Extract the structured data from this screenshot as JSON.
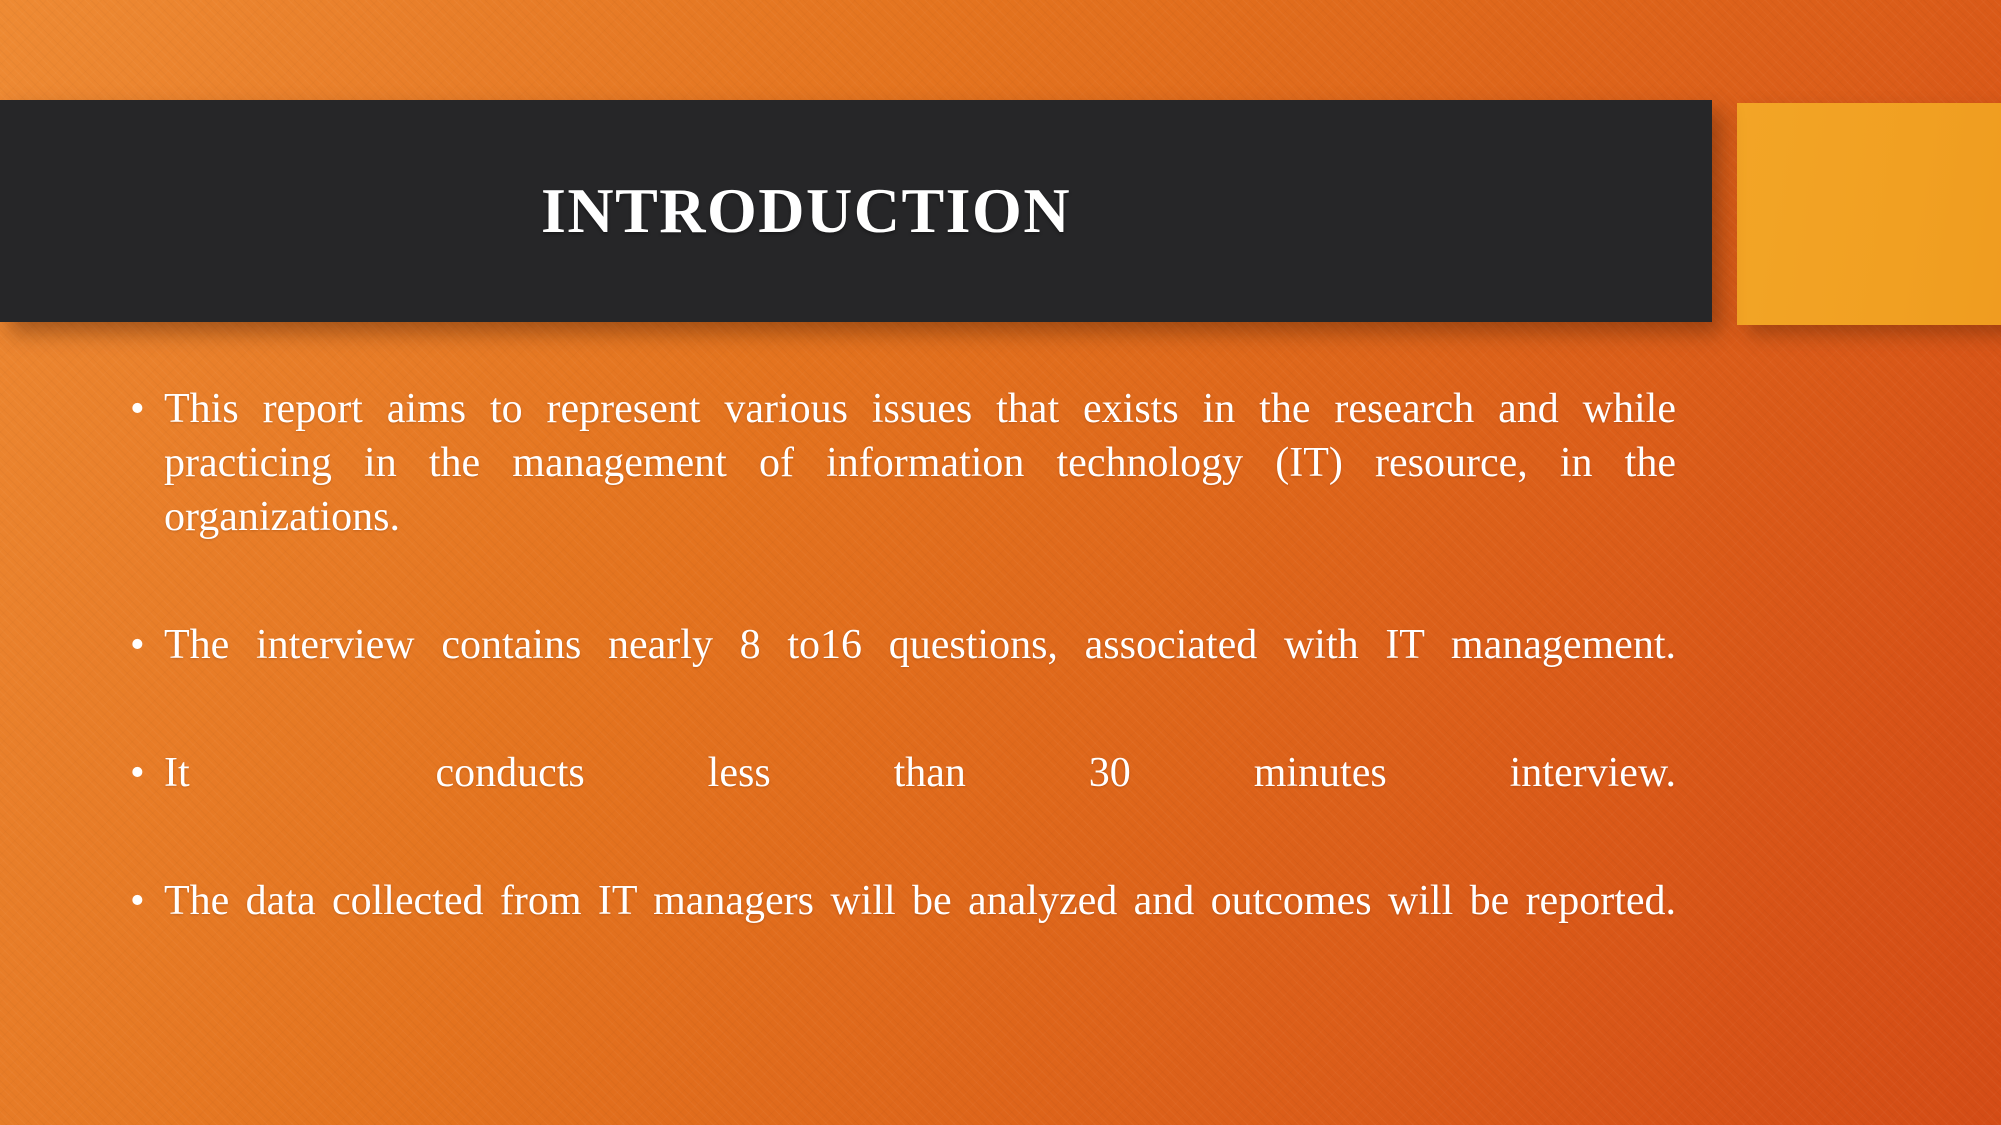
{
  "slide": {
    "title": "INTRODUCTION",
    "background_color_start": "#ee8a33",
    "background_color_end": "#d44c16",
    "title_bar_color": "#262628",
    "accent_block_color": "#f1a022",
    "text_color": "#ffffff",
    "bullet_glyph": "•"
  },
  "bullets": [
    {
      "marker": "•",
      "text": "This report aims to represent various issues that exists in the research and while practicing in the management of information technology (IT) resource, in the organizations."
    },
    {
      "marker": "•",
      "text": "The interview contains nearly 8 to16 questions, associated with IT management."
    },
    {
      "marker": "•",
      "text": "It  conducts less than 30 minutes interview."
    },
    {
      "marker": "•",
      "text": "The data collected from IT managers will be analyzed and outcomes will be reported."
    }
  ]
}
